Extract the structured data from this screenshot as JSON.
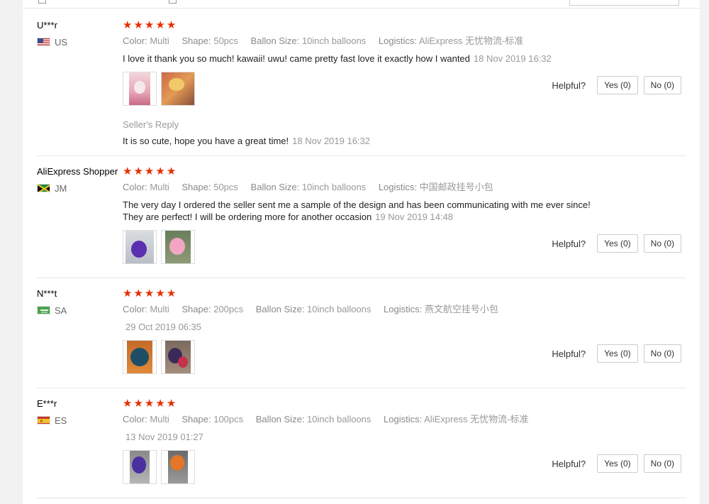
{
  "colors": {
    "star": "#e62e04",
    "muted": "#999999",
    "text": "#222222"
  },
  "labels": {
    "color_key": "Color:",
    "shape_key": "Shape:",
    "size_key": "Ballon Size:",
    "logistics_key": "Logistics:",
    "helpful": "Helpful?",
    "seller_reply": "Seller's Reply"
  },
  "reviews": [
    {
      "name": "U***r",
      "country": "US",
      "rating": 5,
      "color": "Multi",
      "shape": "50pcs",
      "size": "10inch balloons",
      "logistics": "AliExpress 无忧物流-标准",
      "text": "I love it thank you so much! kawaii! uwu! came pretty fast love it exactly how I wanted",
      "time": "18 Nov 2019 16:32",
      "yes": "Yes (0)",
      "no": "No (0)",
      "reply": "It is so cute, hope you have a great time!",
      "reply_time": "18 Nov 2019 16:32"
    },
    {
      "name": "AliExpress Shopper",
      "country": "JM",
      "rating": 5,
      "color": "Multi",
      "shape": "50pcs",
      "size": "10inch balloons",
      "logistics": "中国邮政挂号小包",
      "text_line1": "The very day I ordered the seller sent me a sample of the design and has been communicating with me ever since!",
      "text_line2": "They are perfect! I will be ordering more for another occasion",
      "time": "19 Nov 2019 14:48",
      "yes": "Yes (0)",
      "no": "No (0)"
    },
    {
      "name": "N***t",
      "country": "SA",
      "rating": 5,
      "color": "Multi",
      "shape": "200pcs",
      "size": "10inch balloons",
      "logistics": "燕文航空挂号小包",
      "time": "29 Oct 2019 06:35",
      "yes": "Yes (0)",
      "no": "No (0)"
    },
    {
      "name": "E***r",
      "country": "ES",
      "rating": 5,
      "color": "Multi",
      "shape": "100pcs",
      "size": "10inch balloons",
      "logistics": "AliExpress 无忧物流-标准",
      "time": "13 Nov 2019 01:27",
      "yes": "Yes (0)",
      "no": "No (0)"
    }
  ]
}
